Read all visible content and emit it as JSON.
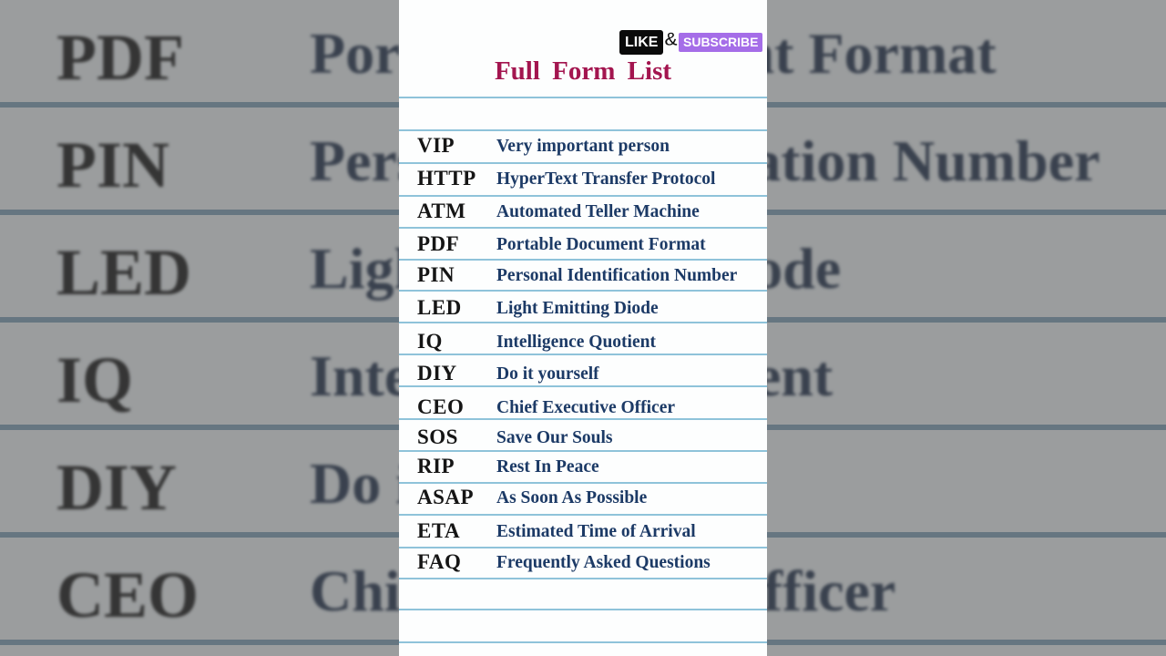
{
  "title": "Full Form  List",
  "badge": {
    "like": "LIKE",
    "amp": "&",
    "subscribe": "SUBSCRIBE"
  },
  "items": [
    {
      "abbr": "VIP",
      "full": "Very important person"
    },
    {
      "abbr": "HTTP",
      "full": "HyperText Transfer Protocol"
    },
    {
      "abbr": "ATM",
      "full": "Automated Teller Machine"
    },
    {
      "abbr": "PDF",
      "full": "Portable Document Format"
    },
    {
      "abbr": "PIN",
      "full": "Personal Identification Number"
    },
    {
      "abbr": "LED",
      "full": "Light Emitting Diode"
    },
    {
      "abbr": "IQ",
      "full": "Intelligence Quotient"
    },
    {
      "abbr": "DIY",
      "full": "Do it yourself"
    },
    {
      "abbr": "CEO",
      "full": "Chief Executive Officer"
    },
    {
      "abbr": "SOS",
      "full": "Save Our Souls"
    },
    {
      "abbr": "RIP",
      "full": "Rest In Peace"
    },
    {
      "abbr": "ASAP",
      "full": "As Soon As Possible"
    },
    {
      "abbr": "ETA",
      "full": "Estimated Time of Arrival"
    },
    {
      "abbr": "FAQ",
      "full": "Frequently Asked Questions"
    }
  ],
  "background": [
    {
      "abbr": "PDF",
      "full": "Portable Document Format"
    },
    {
      "abbr": "PIN",
      "full": "Personal Identification Number"
    },
    {
      "abbr": "LED",
      "full": "Light Emitting Diode"
    },
    {
      "abbr": "IQ",
      "full": "Intelligence Quotient"
    },
    {
      "abbr": "DIY",
      "full": "Do it yourself"
    },
    {
      "abbr": "CEO",
      "full": "Chief Executive Officer"
    }
  ]
}
